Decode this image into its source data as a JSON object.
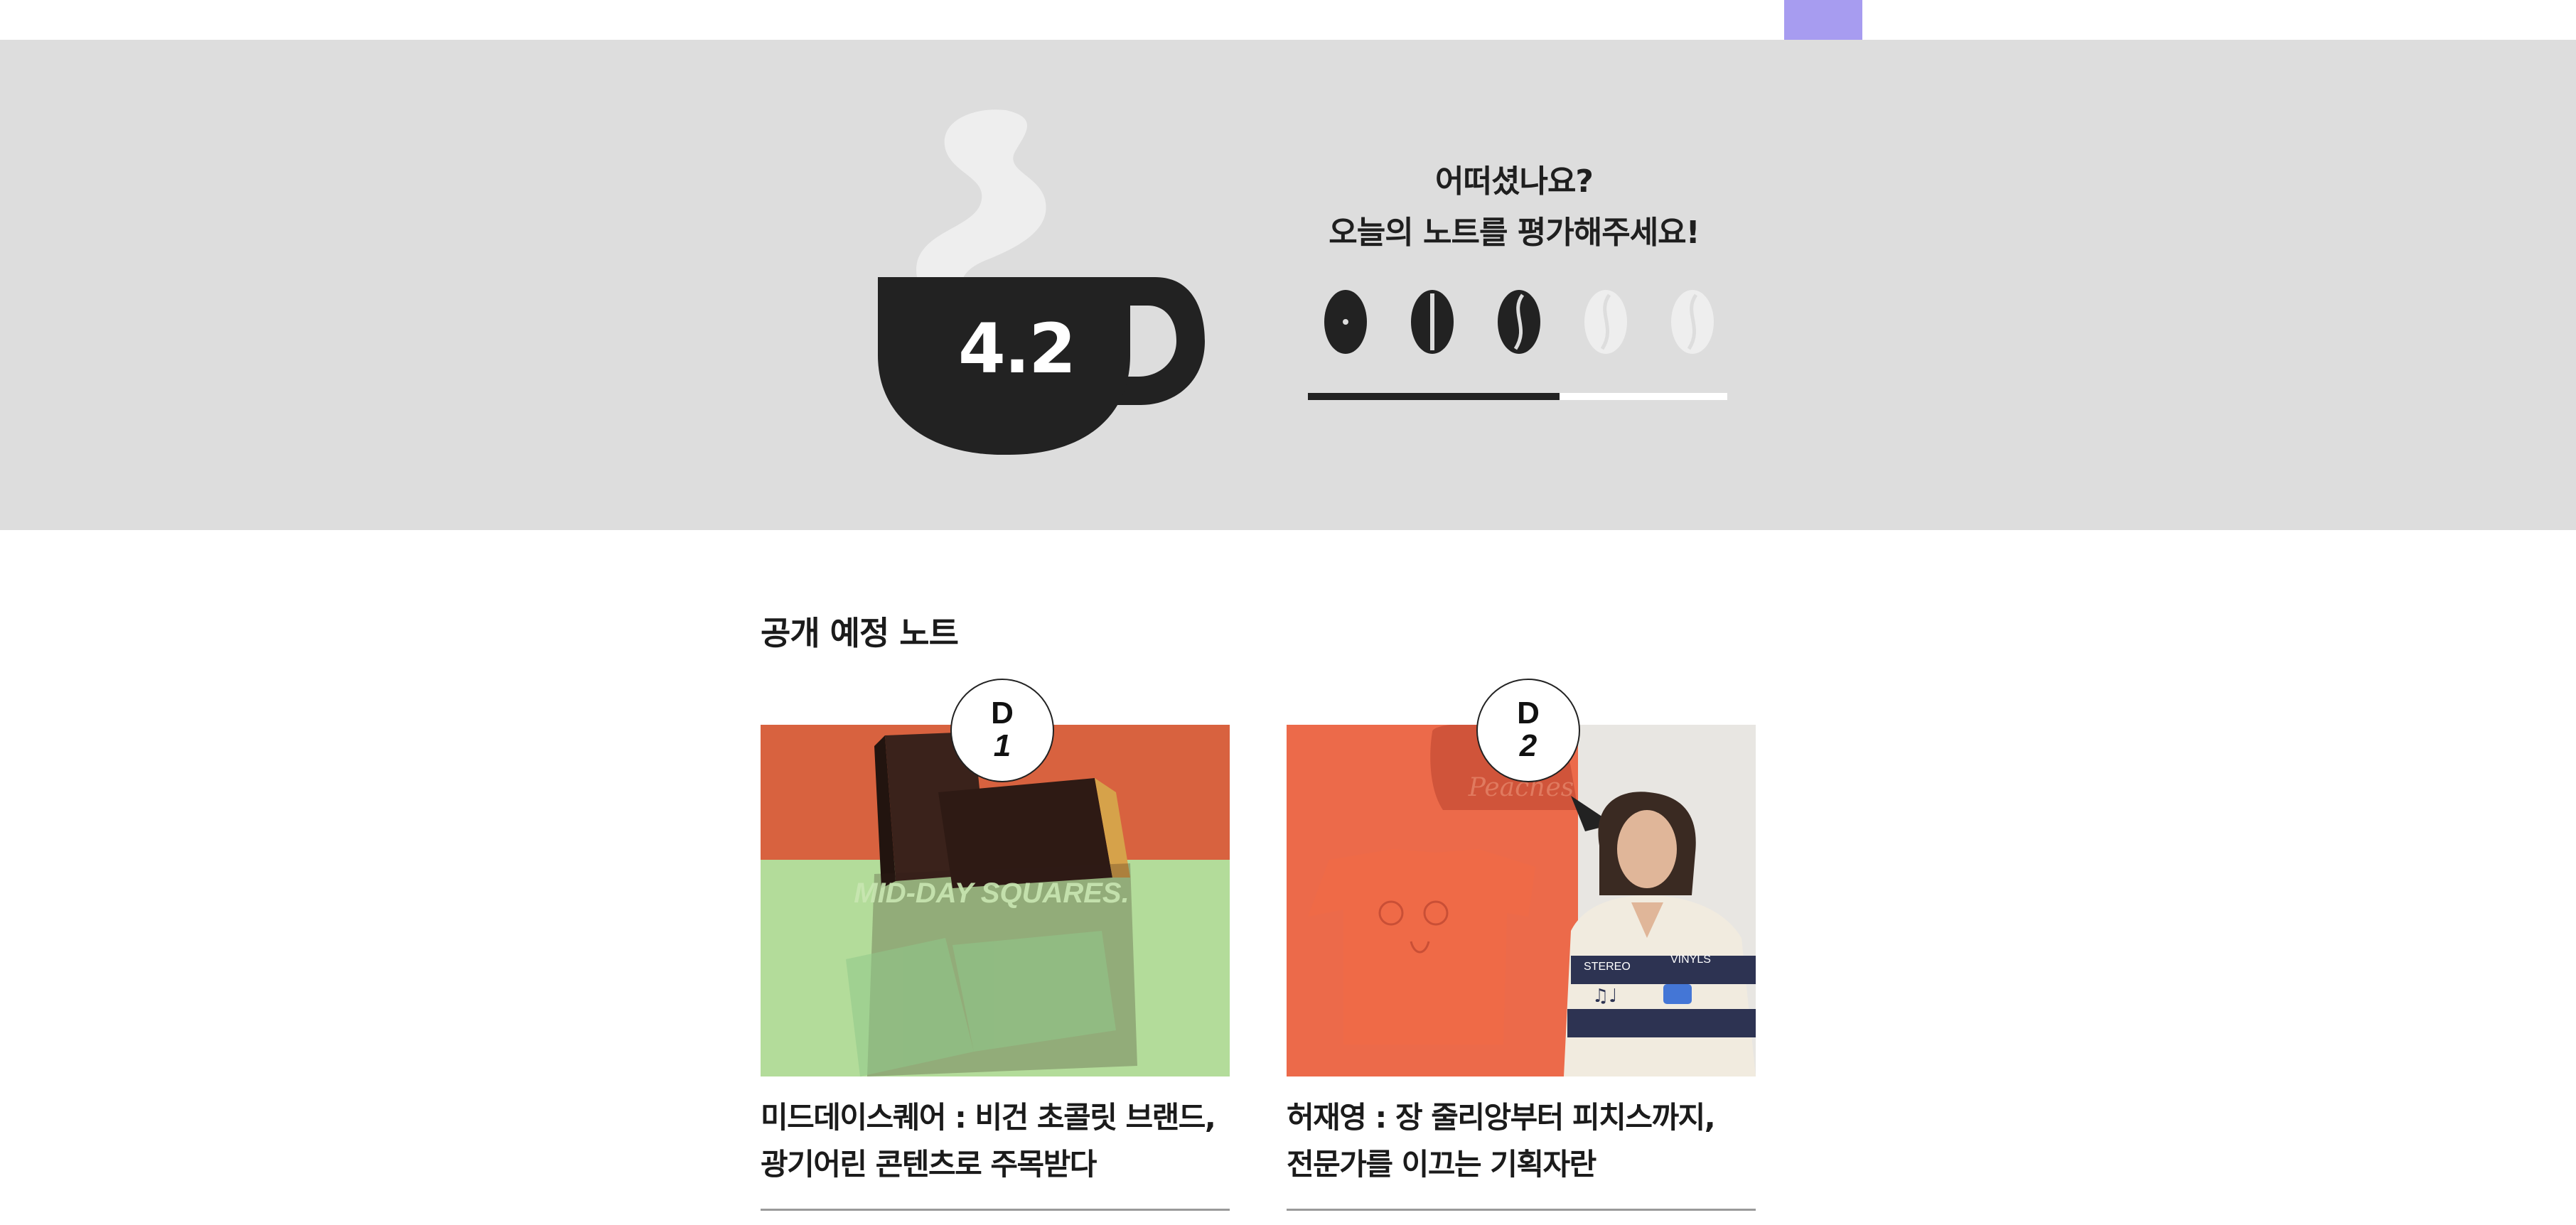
{
  "colors": {
    "accent_tab": "#a79cf0",
    "band_background": "#dddddd",
    "cup": "#222222",
    "steam": "#eeeeee",
    "bean_filled": "#222222",
    "bean_empty": "#eeeeee",
    "card1_top": "#d8623f",
    "card1_bottom": "#b3dc9a",
    "card2_left": "#ec6a4a",
    "card2_right": "#e8e6e2"
  },
  "rating": {
    "score": "4.2",
    "prompt_line1": "어떠셨나요?",
    "prompt_line2": "오늘의 노트를 평가해주세요!",
    "max": 5,
    "value": 3,
    "beans": [
      {
        "icon": "coffee-bean-1-icon",
        "filled": true
      },
      {
        "icon": "coffee-bean-2-icon",
        "filled": true
      },
      {
        "icon": "coffee-bean-3-icon",
        "filled": true
      },
      {
        "icon": "coffee-bean-4-icon",
        "filled": false
      },
      {
        "icon": "coffee-bean-5-icon",
        "filled": false
      }
    ],
    "progress": 0.6
  },
  "upcoming": {
    "section_title": "공개 예정 노트",
    "cards": [
      {
        "dday_letter": "D",
        "dday_number": "1",
        "title_line1": "미드데이스퀘어 : 비건 초콜릿 브랜드,",
        "title_line2": "광기어린 콘텐츠로 주목받다",
        "image_text": "MID-DAY SQUARES."
      },
      {
        "dday_letter": "D",
        "dday_number": "2",
        "title_line1": "허재영 : 장 줄리앙부터 피치스까지,",
        "title_line2": "전문가를 이끄는 기획자란",
        "image_text_1": "STEREO",
        "image_text_2": "VINYLS",
        "image_text_3": "Peaches"
      }
    ]
  }
}
